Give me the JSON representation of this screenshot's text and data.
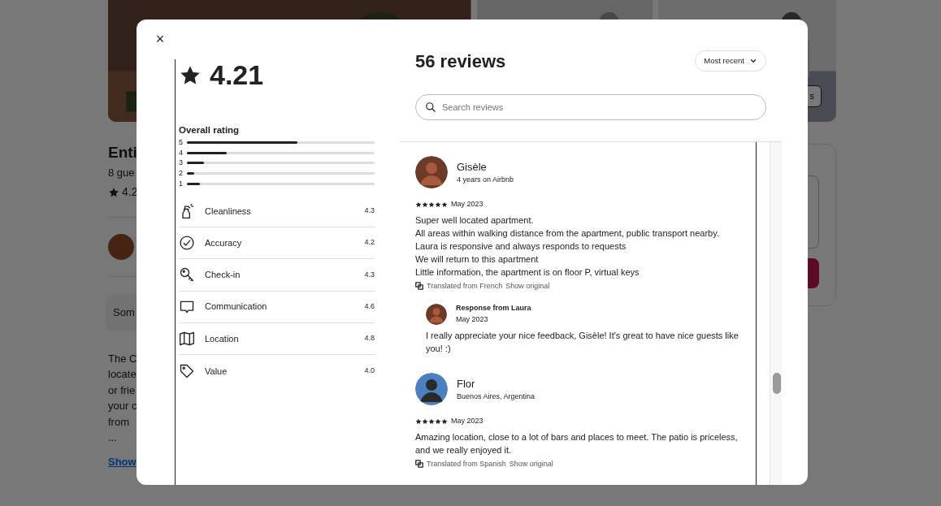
{
  "background_page": {
    "title": "Enti",
    "subtitle": "8 gue",
    "rating": "4.2",
    "highlight": "Som",
    "description_lines": [
      "The C",
      "locate",
      "or frie",
      "your c",
      "from",
      "..."
    ],
    "show_more": "Show",
    "photo_button": "s"
  },
  "modal": {
    "close": "×",
    "overall": "4.21",
    "overall_label": "Overall rating",
    "distribution": [
      {
        "label": "5",
        "level": 0.59
      },
      {
        "label": "4",
        "level": 0.21
      },
      {
        "label": "3",
        "level": 0.09
      },
      {
        "label": "2",
        "level": 0.04
      },
      {
        "label": "1",
        "level": 0.07
      }
    ],
    "categories": [
      {
        "kind": "spray",
        "name": "Cleanliness",
        "score": "4.3"
      },
      {
        "kind": "check",
        "name": "Accuracy",
        "score": "4.2"
      },
      {
        "kind": "key",
        "name": "Check-in",
        "score": "4.3"
      },
      {
        "kind": "chat",
        "name": "Communication",
        "score": "4.6"
      },
      {
        "kind": "map",
        "name": "Location",
        "score": "4.8"
      },
      {
        "kind": "tag",
        "name": "Value",
        "score": "4.0"
      }
    ],
    "reviews_title": "56 reviews",
    "sort": "Most recent",
    "search": {
      "placeholder": "Search reviews"
    },
    "reviews": [
      {
        "name": "Gisèle",
        "meta": "4 years on Airbnb",
        "stars": 5,
        "date": "May 2023",
        "lines": [
          "Super well located apartment.",
          "All areas within walking distance from the apartment, public transport nearby.",
          "Laura is responsive and always responds to requests",
          "We will return to this apartment",
          "Little information, the apartment is on floor P, virtual keys"
        ],
        "translated": "Translated from French",
        "show_original": "Show original",
        "response": {
          "title": "Response from Laura",
          "date": "May 2023",
          "text": "I really appreciate your nice feedback, Gisèle! It's great to have nice guests like you! :)"
        }
      },
      {
        "name": "Flor",
        "meta": "Buenos Aires, Argentina",
        "stars": 5,
        "date": "May 2023",
        "lines": [
          "Amazing location, close to a lot of bars and places to meet. The patio is priceless, and we really enjoyed it."
        ],
        "translated": "Translated from Spanish",
        "show_original": "Show original"
      }
    ]
  }
}
